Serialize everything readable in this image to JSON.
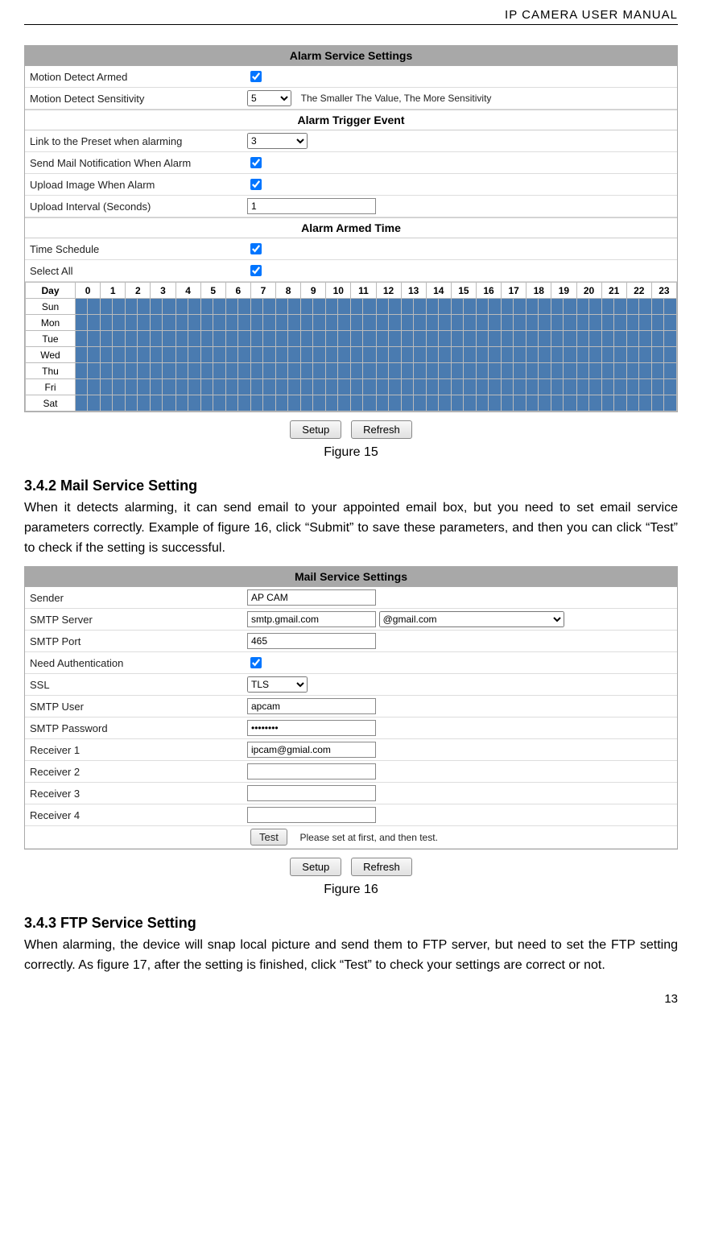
{
  "doc": {
    "header": "IP CAMERA USER MANUAL",
    "page_number": "13"
  },
  "alarm": {
    "title": "Alarm Service Settings",
    "rows": {
      "motion_armed": {
        "label": "Motion Detect Armed",
        "checked": true
      },
      "motion_sens": {
        "label": "Motion Detect Sensitivity",
        "value": "5",
        "hint": "The Smaller The Value, The More Sensitivity"
      }
    },
    "trigger_title": "Alarm Trigger Event",
    "trigger": {
      "preset": {
        "label": "Link to the Preset when alarming",
        "value": "3"
      },
      "mail": {
        "label": "Send Mail Notification When Alarm",
        "checked": true
      },
      "upload": {
        "label": "Upload Image When Alarm",
        "checked": true
      },
      "interval": {
        "label": "Upload Interval (Seconds)",
        "value": "1"
      }
    },
    "armed_time_title": "Alarm Armed Time",
    "armed": {
      "time_schedule": {
        "label": "Time Schedule",
        "checked": true
      },
      "select_all": {
        "label": "Select All",
        "checked": true
      }
    },
    "schedule": {
      "day_header": "Day",
      "hours": [
        "0",
        "1",
        "2",
        "3",
        "4",
        "5",
        "6",
        "7",
        "8",
        "9",
        "10",
        "11",
        "12",
        "13",
        "14",
        "15",
        "16",
        "17",
        "18",
        "19",
        "20",
        "21",
        "22",
        "23"
      ],
      "days": [
        "Sun",
        "Mon",
        "Tue",
        "Wed",
        "Thu",
        "Fri",
        "Sat"
      ]
    }
  },
  "buttons": {
    "setup": "Setup",
    "refresh": "Refresh",
    "test": "Test"
  },
  "captions": {
    "fig15": "Figure 15",
    "fig16": "Figure 16"
  },
  "section_342": {
    "title": "3.4.2   Mail Service Setting",
    "body": "When it detects alarming, it can send email to your appointed email box, but you need to set email service parameters correctly. Example of figure 16, click “Submit” to save these parameters, and then you can click “Test” to check if the setting is successful."
  },
  "mail": {
    "title": "Mail Service Settings",
    "rows": {
      "sender": {
        "label": "Sender",
        "value": "AP CAM"
      },
      "smtp_srv": {
        "label": "SMTP Server",
        "value": "smtp.gmail.com",
        "domain": "@gmail.com"
      },
      "smtp_port": {
        "label": "SMTP Port",
        "value": "465"
      },
      "need_auth": {
        "label": "Need Authentication",
        "checked": true
      },
      "ssl": {
        "label": "SSL",
        "value": "TLS"
      },
      "smtp_user": {
        "label": "SMTP User",
        "value": "apcam"
      },
      "smtp_pass": {
        "label": "SMTP Password",
        "value": "••••••••"
      },
      "recv1": {
        "label": "Receiver 1",
        "value": "ipcam@gmial.com"
      },
      "recv2": {
        "label": "Receiver 2",
        "value": ""
      },
      "recv3": {
        "label": "Receiver 3",
        "value": ""
      },
      "recv4": {
        "label": "Receiver 4",
        "value": ""
      }
    },
    "test_hint": "Please set at first, and then test."
  },
  "section_343": {
    "title": "3.4.3   FTP Service Setting",
    "body": "When alarming, the device will snap local picture and send them to FTP server, but need to set the FTP setting correctly. As figure 17, after the setting is finished, click “Test” to check your settings are correct or not."
  }
}
